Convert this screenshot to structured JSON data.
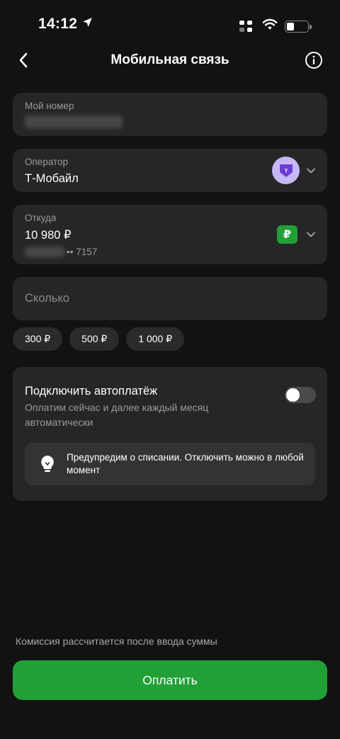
{
  "status_bar": {
    "time": "14:12",
    "icons": [
      "location-arrow-icon",
      "cellular-signal-icon",
      "wifi-icon",
      "battery-icon"
    ],
    "battery_level": 0.25
  },
  "nav": {
    "title": "Мобильная связь",
    "back_icon": "chevron-left-icon",
    "info_icon": "info-icon"
  },
  "phone_field": {
    "label": "Мой номер"
  },
  "operator_field": {
    "label": "Оператор",
    "value": "Т-Мобайл",
    "logo_letter": "т",
    "logo_color": "#c7b8f5",
    "logo_accent": "#6b3fd1"
  },
  "source_field": {
    "label": "Откуда",
    "balance": "10 980 ₽",
    "card_suffix": "•• 7157",
    "badge": "₽",
    "badge_color": "#21a038"
  },
  "amount_field": {
    "placeholder": "Сколько"
  },
  "quick_amounts": [
    "300 ₽",
    "500 ₽",
    "1 000 ₽"
  ],
  "autopay": {
    "title": "Подключить автоплатёж",
    "subtitle": "Оплатим сейчас и далее каждый месяц автоматически",
    "enabled": false,
    "hint": "Предупредим о списании. Отключить можно в любой момент",
    "hint_icon": "lightbulb-icon"
  },
  "footer": {
    "commission_note": "Комиссия рассчитается после ввода суммы",
    "pay_label": "Оплатить"
  },
  "colors": {
    "background": "#121212",
    "card": "#262626",
    "accent_green": "#21a038"
  }
}
